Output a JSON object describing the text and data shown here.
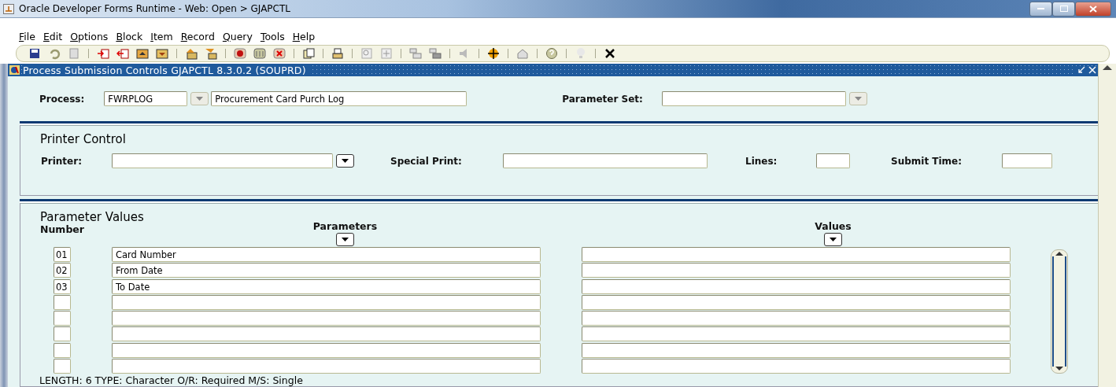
{
  "window": {
    "title": "Oracle Developer Forms Runtime - Web:  Open > GJAPCTL"
  },
  "menu": [
    "File",
    "Edit",
    "Options",
    "Block",
    "Item",
    "Record",
    "Query",
    "Tools",
    "Help"
  ],
  "form": {
    "title": "Process Submission Controls  GJAPCTL  8.3.0.2  (SOUPRD)"
  },
  "process": {
    "label": "Process:",
    "code": "FWRPLOG",
    "description": "Procurement Card Purch Log",
    "list_disabled": true
  },
  "parameter_set": {
    "label": "Parameter Set:",
    "list_disabled": true
  },
  "printer_control": {
    "title": "Printer Control",
    "fields": [
      {
        "kind": "list",
        "label": "Printer:",
        "list_disabled": false
      },
      {
        "kind": "text",
        "label": "Special Print:"
      },
      {
        "kind": "short",
        "label": "Lines:"
      },
      {
        "kind": "time",
        "label": "Submit Time:"
      }
    ]
  },
  "parameter_values": {
    "title": "Parameter Values",
    "number_header": "Number",
    "columns": [
      {
        "label": "Parameters",
        "list_disabled": false
      },
      {
        "label": "Values",
        "list_disabled": false
      }
    ],
    "rows": [
      {
        "number": "01",
        "parameter": "Card Number"
      },
      {
        "number": "02",
        "parameter": "From Date"
      },
      {
        "number": "03",
        "parameter": "To Date"
      },
      {},
      {},
      {},
      {},
      {}
    ]
  },
  "status_bar": "LENGTH: 6 TYPE: Character O/R: Required M/S: Single"
}
